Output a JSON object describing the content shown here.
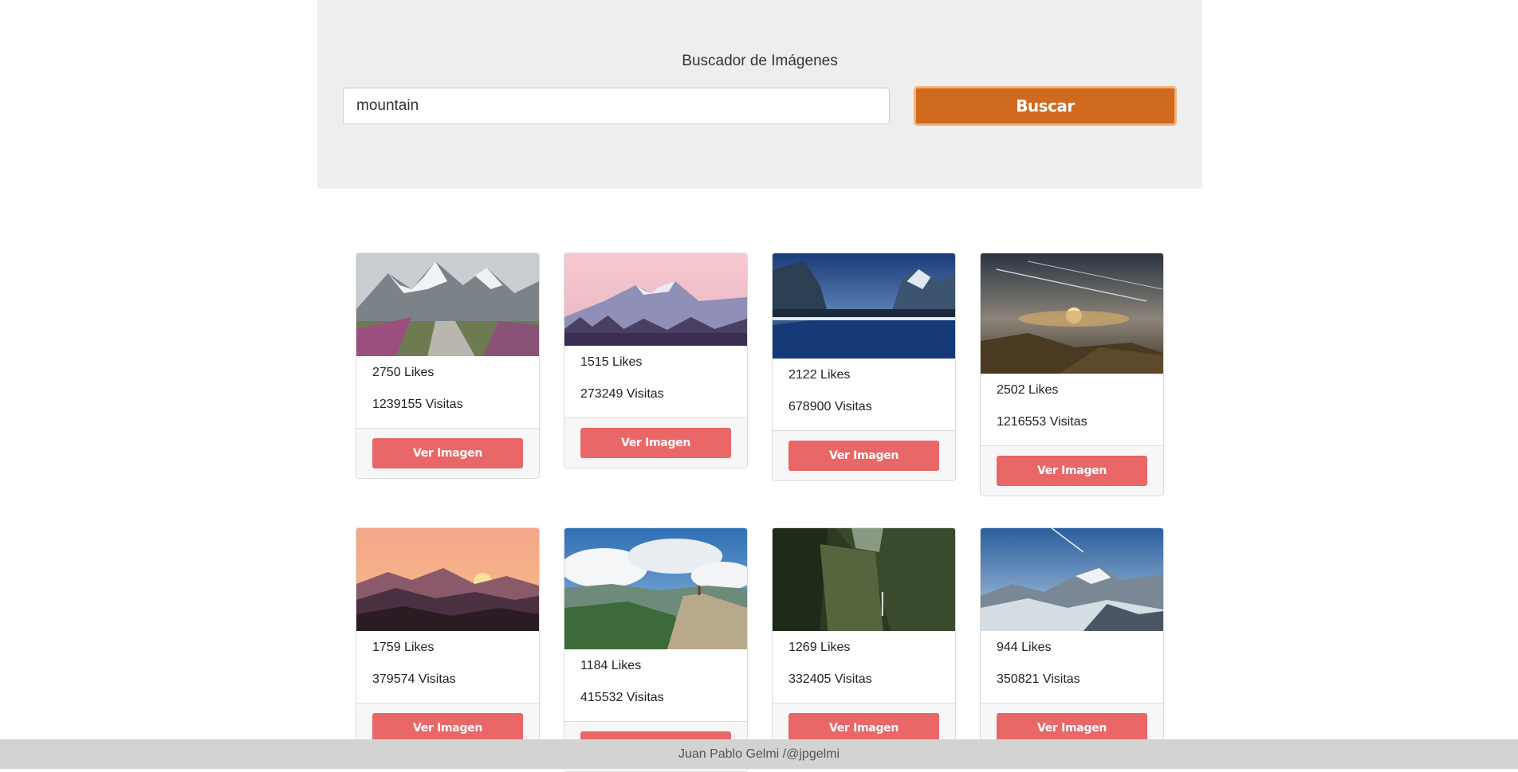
{
  "header": {
    "title": "Buscador de Imágenes",
    "search_value": "mountain",
    "search_button": "Buscar"
  },
  "colors": {
    "accent": "#cf6a1e",
    "card_button": "#e96767",
    "jumbotron_bg": "#eeeeee",
    "footer_bg": "#d3d3d3"
  },
  "results": [
    {
      "likes": "2750 Likes",
      "views": "1239155 Visitas",
      "button": "Ver Imagen",
      "scene": "alpine-path"
    },
    {
      "likes": "1515 Likes",
      "views": "273249 Visitas",
      "button": "Ver Imagen",
      "scene": "pink-sky-mountains"
    },
    {
      "likes": "2122 Likes",
      "views": "678900 Visitas",
      "button": "Ver Imagen",
      "scene": "yosemite-reflection"
    },
    {
      "likes": "2502 Likes",
      "views": "1216553 Visitas",
      "button": "Ver Imagen",
      "scene": "sunset-clouds"
    },
    {
      "likes": "1759 Likes",
      "views": "379574 Visitas",
      "button": "Ver Imagen",
      "scene": "orange-sunset-ridges"
    },
    {
      "likes": "1184 Likes",
      "views": "415532 Visitas",
      "button": "Ver Imagen",
      "scene": "hiker-cliff"
    },
    {
      "likes": "1269 Likes",
      "views": "332405 Visitas",
      "button": "Ver Imagen",
      "scene": "green-canyon"
    },
    {
      "likes": "944 Likes",
      "views": "350821 Visitas",
      "button": "Ver Imagen",
      "scene": "snowy-peaks"
    }
  ],
  "footer": {
    "text": "Juan Pablo Gelmi /@jpgelmi"
  }
}
